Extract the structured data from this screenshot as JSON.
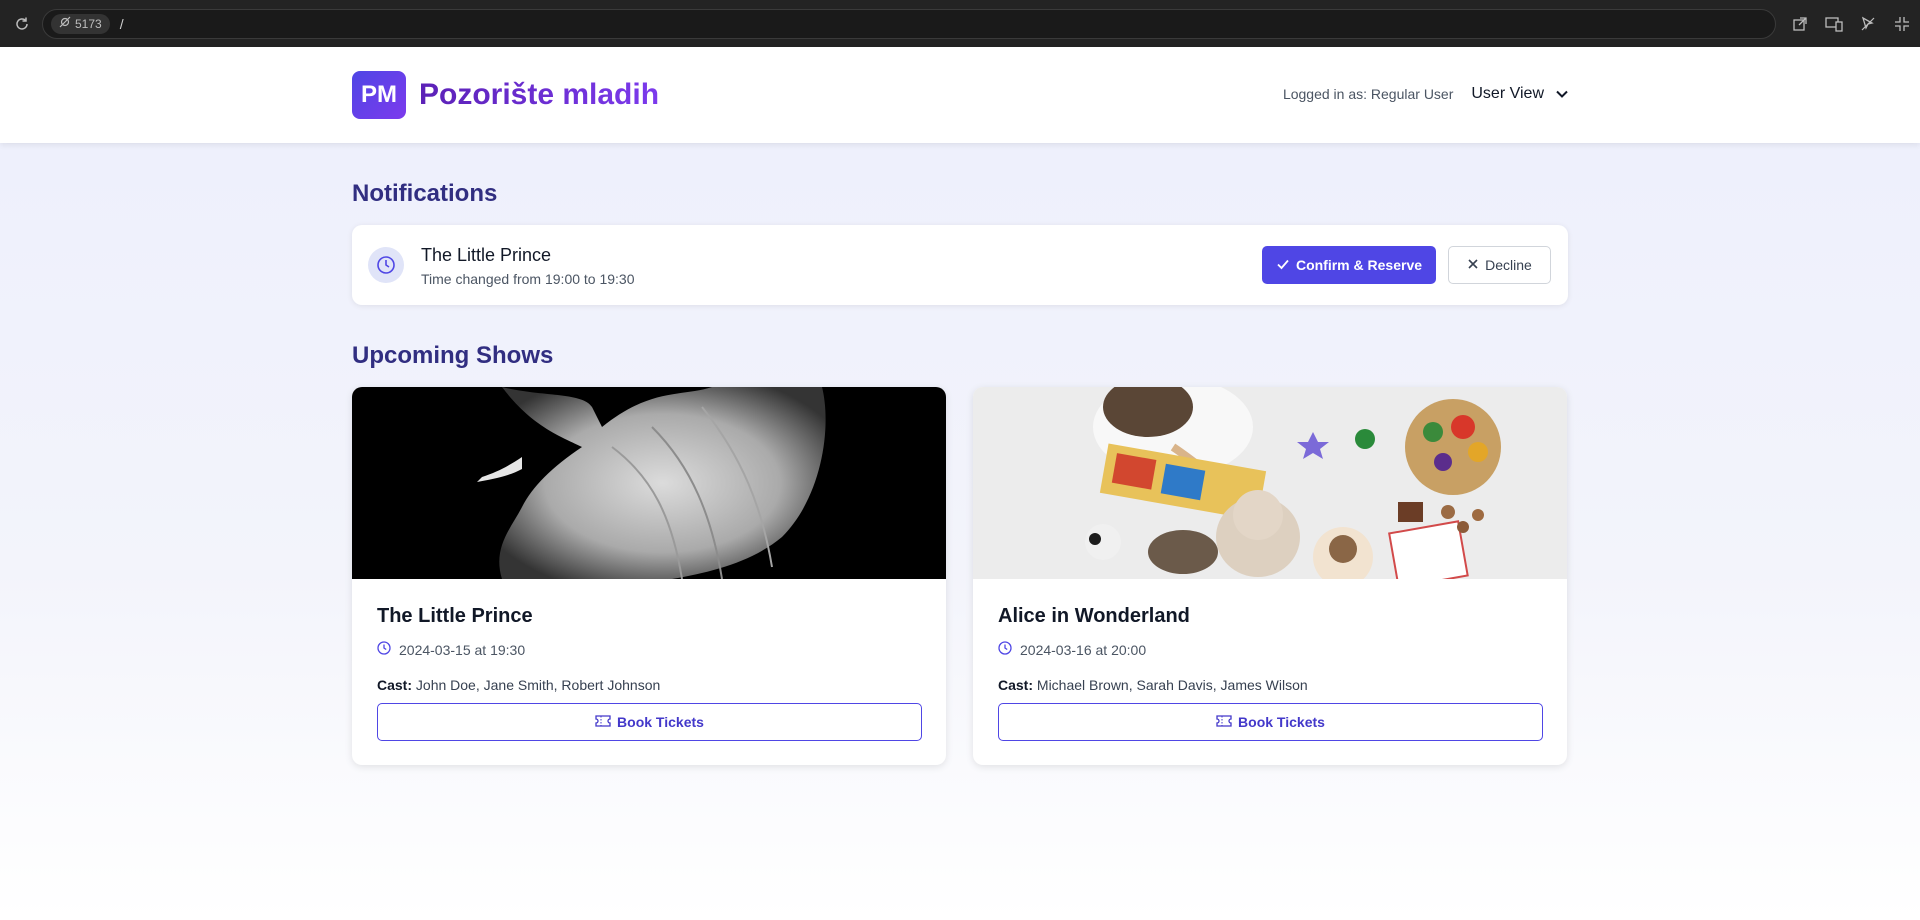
{
  "browser": {
    "port": "5173",
    "path": "/"
  },
  "header": {
    "logo_text": "PM",
    "brand_name": "Pozorište mladih",
    "logged_in_text": "Logged in as: Regular User",
    "view_select_value": "User View"
  },
  "notifications": {
    "section_title": "Notifications",
    "items": [
      {
        "title": "The Little Prince",
        "message": "Time changed from 19:00 to 19:30",
        "confirm_label": "Confirm & Reserve",
        "decline_label": "Decline"
      }
    ]
  },
  "shows": {
    "section_title": "Upcoming Shows",
    "items": [
      {
        "title": "The Little Prince",
        "datetime": "2024-03-15 at 19:30",
        "cast_label": "Cast:",
        "cast": "John Doe, Jane Smith, Robert Johnson",
        "book_label": "Book Tickets"
      },
      {
        "title": "Alice in Wonderland",
        "datetime": "2024-03-16 at 20:00",
        "cast_label": "Cast:",
        "cast": "Michael Brown, Sarah Davis, James Wilson",
        "book_label": "Book Tickets"
      }
    ]
  },
  "colors": {
    "accent": "#4f46e5",
    "brand": "#6d28d9",
    "heading": "#312e81"
  }
}
